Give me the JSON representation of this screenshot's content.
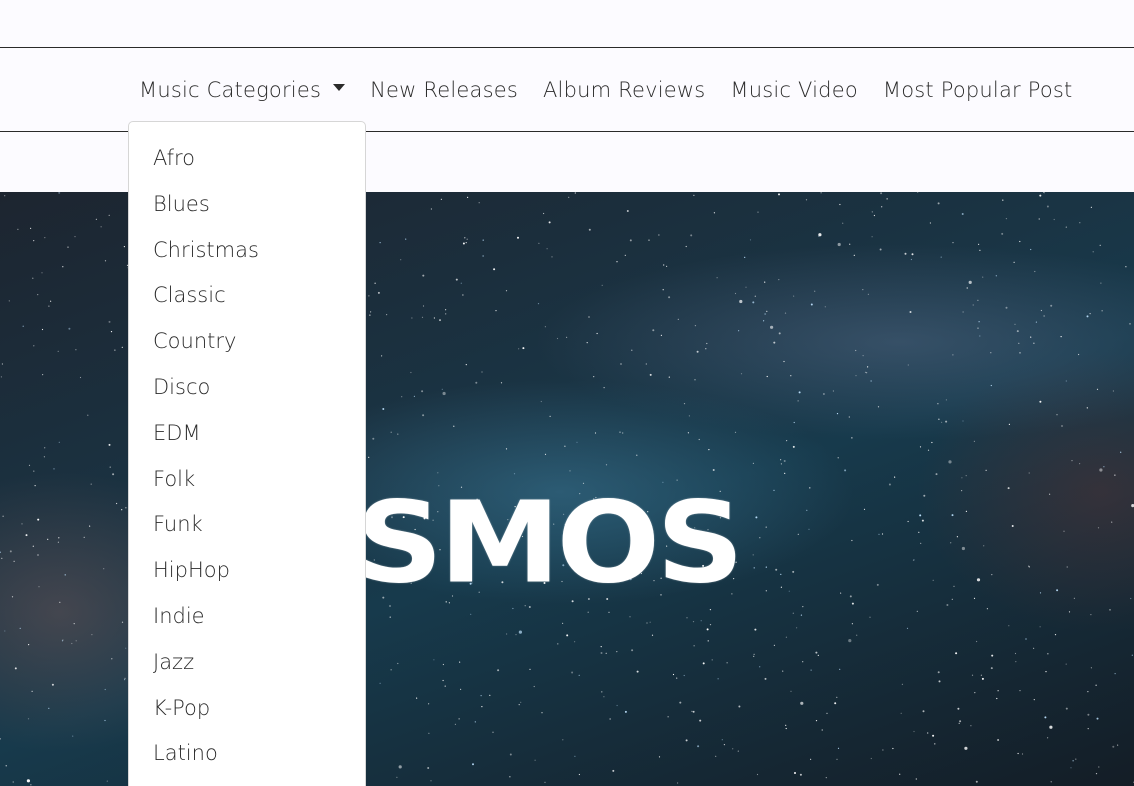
{
  "nav": {
    "items": [
      {
        "label": "Music Categories",
        "has_dropdown": true
      },
      {
        "label": "New Releases"
      },
      {
        "label": "Album Reviews"
      },
      {
        "label": "Music Video"
      },
      {
        "label": "Most Popular Post"
      }
    ]
  },
  "dropdown": {
    "items": [
      "Afro",
      "Blues",
      "Christmas",
      "Classic",
      "Country",
      "Disco",
      "EDM",
      "Folk",
      "Funk",
      "HipHop",
      "Indie",
      "Jazz",
      "K-Pop",
      "Latino"
    ]
  },
  "hero": {
    "title": "COSMOS"
  },
  "colors": {
    "page_background": "#fcfbff",
    "text": "#2b2b2b",
    "hero_title": "#ffffff"
  },
  "icons": {
    "dropdown_caret": "caret-down-icon"
  }
}
